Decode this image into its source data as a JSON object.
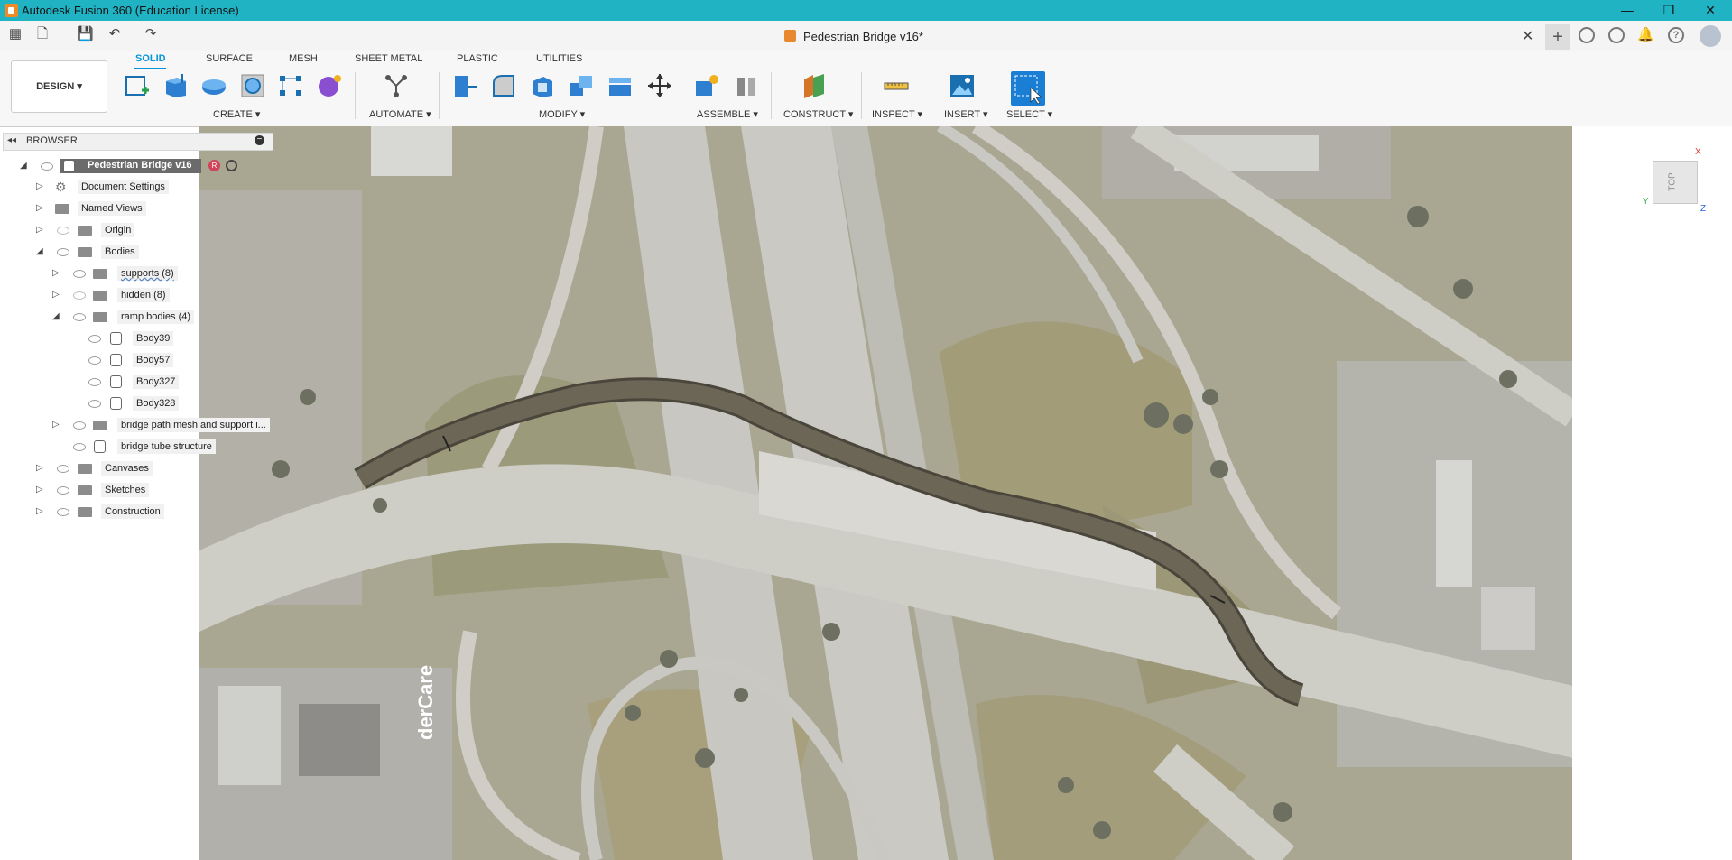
{
  "app": {
    "title": "Autodesk Fusion 360 (Education License)",
    "window_controls": [
      "—",
      "❐",
      "✕"
    ]
  },
  "document": {
    "tab_title": "Pedestrian Bridge v16*"
  },
  "workspace": {
    "design_button": "DESIGN ▾"
  },
  "ribbon": {
    "tabs": [
      "SOLID",
      "SURFACE",
      "MESH",
      "SHEET METAL",
      "PLASTIC",
      "UTILITIES"
    ],
    "active_tab": "SOLID",
    "groups": [
      "CREATE ▾",
      "AUTOMATE ▾",
      "MODIFY ▾",
      "ASSEMBLE ▾",
      "CONSTRUCT ▾",
      "INSPECT ▾",
      "INSERT ▾",
      "SELECT ▾"
    ]
  },
  "browser": {
    "label": "BROWSER",
    "root": "Pedestrian Bridge v16",
    "items": [
      {
        "label": "Document Settings"
      },
      {
        "label": "Named Views"
      },
      {
        "label": "Origin"
      },
      {
        "label": "Bodies"
      },
      {
        "label": "supports (8)"
      },
      {
        "label": "hidden (8)"
      },
      {
        "label": "ramp bodies (4)"
      },
      {
        "label": "Body39"
      },
      {
        "label": "Body57"
      },
      {
        "label": "Body327"
      },
      {
        "label": "Body328"
      },
      {
        "label": "bridge path mesh and support i..."
      },
      {
        "label": "bridge tube structure"
      },
      {
        "label": "Canvases"
      },
      {
        "label": "Sketches"
      },
      {
        "label": "Construction"
      }
    ]
  },
  "canvas": {
    "watermark_text": "derCare"
  },
  "viewcube": {
    "face": "TOP",
    "axes": [
      "X",
      "Y",
      "Z"
    ]
  },
  "colors": {
    "titlebar": "#1fb3c4",
    "accent": "#0696d7",
    "select_tool": "#1a7fd4"
  }
}
